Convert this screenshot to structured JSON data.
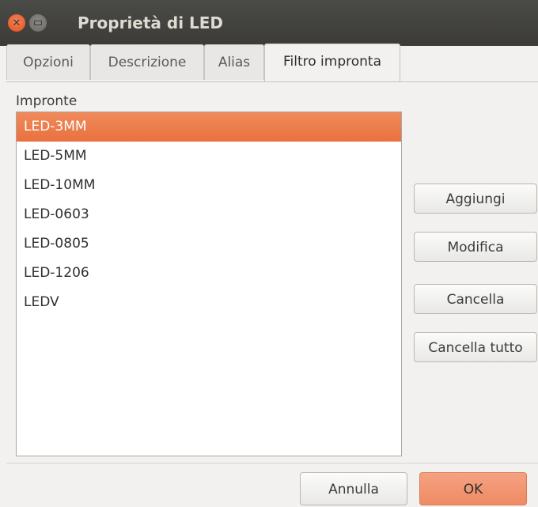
{
  "window": {
    "title": "Proprietà di LED"
  },
  "tabs": [
    {
      "label": "Opzioni"
    },
    {
      "label": "Descrizione"
    },
    {
      "label": "Alias"
    },
    {
      "label": "Filtro impronta",
      "active": true
    }
  ],
  "footprints": {
    "label": "Impronte",
    "items": [
      "LED-3MM",
      "LED-5MM",
      "LED-10MM",
      "LED-0603",
      "LED-0805",
      "LED-1206",
      "LEDV"
    ],
    "selected": "LED-3MM"
  },
  "side_buttons": {
    "add": "Aggiungi",
    "edit": "Modifica",
    "delete": "Cancella",
    "delete_all": "Cancella tutto"
  },
  "footer": {
    "cancel": "Annulla",
    "ok": "OK"
  },
  "colors": {
    "accent": "#e9713f",
    "titlebar": "#3c3b37"
  }
}
